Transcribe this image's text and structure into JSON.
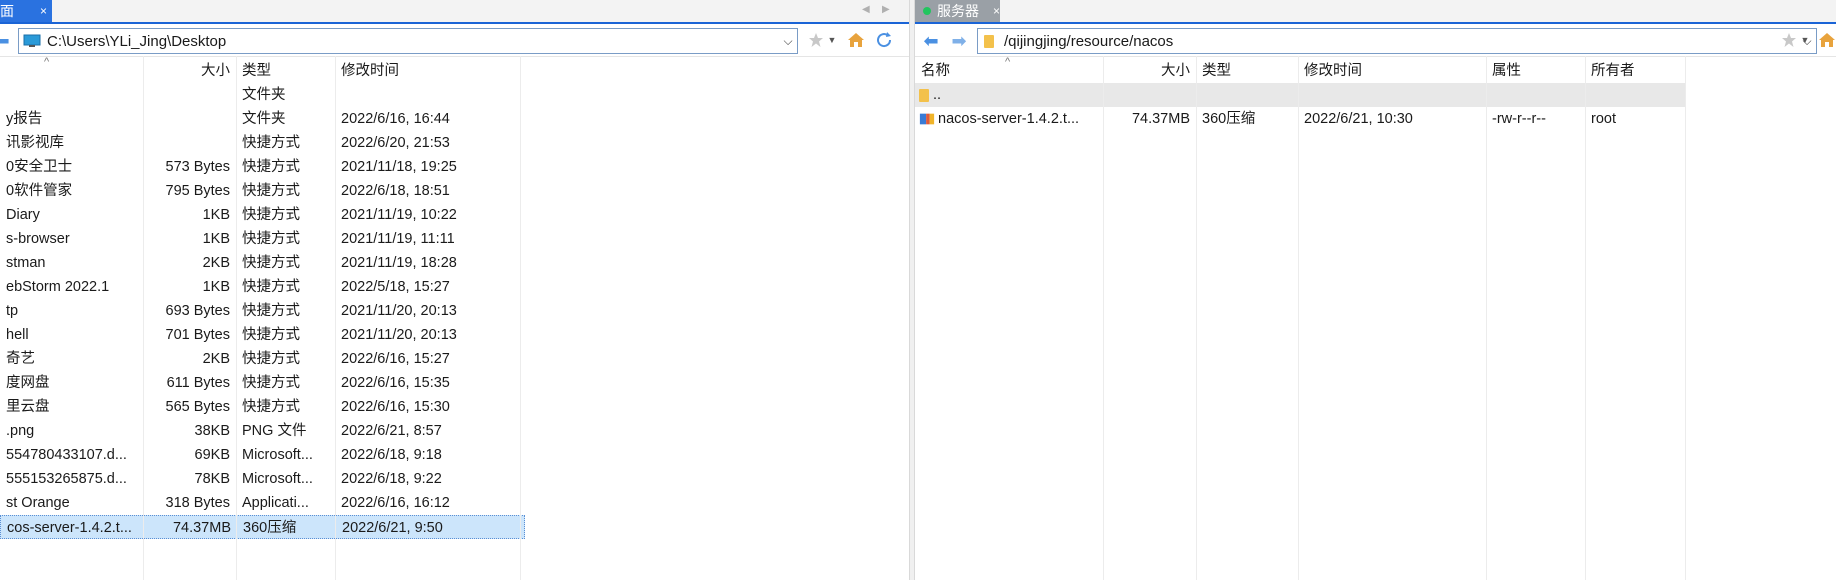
{
  "left": {
    "tab": {
      "label": "面",
      "close": "×"
    },
    "path": "C:\\Users\\YLi_Jing\\Desktop",
    "columns": {
      "name": "",
      "size": "大小",
      "type": "类型",
      "modified": "修改时间"
    },
    "rows": [
      {
        "name": "",
        "size": "",
        "type": "文件夹",
        "modified": ""
      },
      {
        "name": "y报告",
        "size": "",
        "type": "文件夹",
        "modified": "2022/6/16, 16:44"
      },
      {
        "name": "讯影视库",
        "size": "",
        "type": "快捷方式",
        "modified": "2022/6/20, 21:53"
      },
      {
        "name": "0安全卫士",
        "size": "573 Bytes",
        "type": "快捷方式",
        "modified": "2021/11/18, 19:25"
      },
      {
        "name": "0软件管家",
        "size": "795 Bytes",
        "type": "快捷方式",
        "modified": "2022/6/18, 18:51"
      },
      {
        "name": "Diary",
        "size": "1KB",
        "type": "快捷方式",
        "modified": "2021/11/19, 10:22"
      },
      {
        "name": "s-browser",
        "size": "1KB",
        "type": "快捷方式",
        "modified": "2021/11/19, 11:11"
      },
      {
        "name": "stman",
        "size": "2KB",
        "type": "快捷方式",
        "modified": "2021/11/19, 18:28"
      },
      {
        "name": "ebStorm 2022.1",
        "size": "1KB",
        "type": "快捷方式",
        "modified": "2022/5/18, 15:27"
      },
      {
        "name": "tp",
        "size": "693 Bytes",
        "type": "快捷方式",
        "modified": "2021/11/20, 20:13"
      },
      {
        "name": "hell",
        "size": "701 Bytes",
        "type": "快捷方式",
        "modified": "2021/11/20, 20:13"
      },
      {
        "name": "奇艺",
        "size": "2KB",
        "type": "快捷方式",
        "modified": "2022/6/16, 15:27"
      },
      {
        "name": "度网盘",
        "size": "611 Bytes",
        "type": "快捷方式",
        "modified": "2022/6/16, 15:35"
      },
      {
        "name": "里云盘",
        "size": "565 Bytes",
        "type": "快捷方式",
        "modified": "2022/6/16, 15:30"
      },
      {
        "name": ".png",
        "size": "38KB",
        "type": "PNG 文件",
        "modified": "2022/6/21, 8:57"
      },
      {
        "name": "554780433107.d...",
        "size": "69KB",
        "type": "Microsoft...",
        "modified": "2022/6/18, 9:18"
      },
      {
        "name": "555153265875.d...",
        "size": "78KB",
        "type": "Microsoft...",
        "modified": "2022/6/18, 9:22"
      },
      {
        "name": "st Orange",
        "size": "318 Bytes",
        "type": "Applicati...",
        "modified": "2022/6/16, 16:12"
      },
      {
        "name": "cos-server-1.4.2.t...",
        "size": "74.37MB",
        "type": "360压缩",
        "modified": "2022/6/21, 9:50"
      }
    ]
  },
  "right": {
    "tab": {
      "label": "服务器",
      "close": "×"
    },
    "path": "/qijingjing/resource/nacos",
    "columns": {
      "name": "名称",
      "size": "大小",
      "type": "类型",
      "modified": "修改时间",
      "attr": "属性",
      "owner": "所有者"
    },
    "rows": [
      {
        "name": "..",
        "size": "",
        "type": "",
        "modified": "",
        "attr": "",
        "owner": ""
      },
      {
        "name": "nacos-server-1.4.2.t...",
        "size": "74.37MB",
        "type": "360压缩",
        "modified": "2022/6/21, 10:30",
        "attr": "-rw-r--r--",
        "owner": "root"
      }
    ]
  },
  "icons": {
    "back": "arrow-left-icon",
    "forward": "arrow-right-icon",
    "dropdown": "chevron-down-icon",
    "bookmark": "star-icon",
    "home": "home-icon",
    "refresh": "refresh-icon",
    "computer": "computer-icon",
    "folder": "folder-icon",
    "archive": "archive-icon"
  },
  "colors": {
    "accent": "#2a72e0",
    "selected": "#cce5fb",
    "folder": "#f3c14b",
    "connected": "#22c55e"
  }
}
